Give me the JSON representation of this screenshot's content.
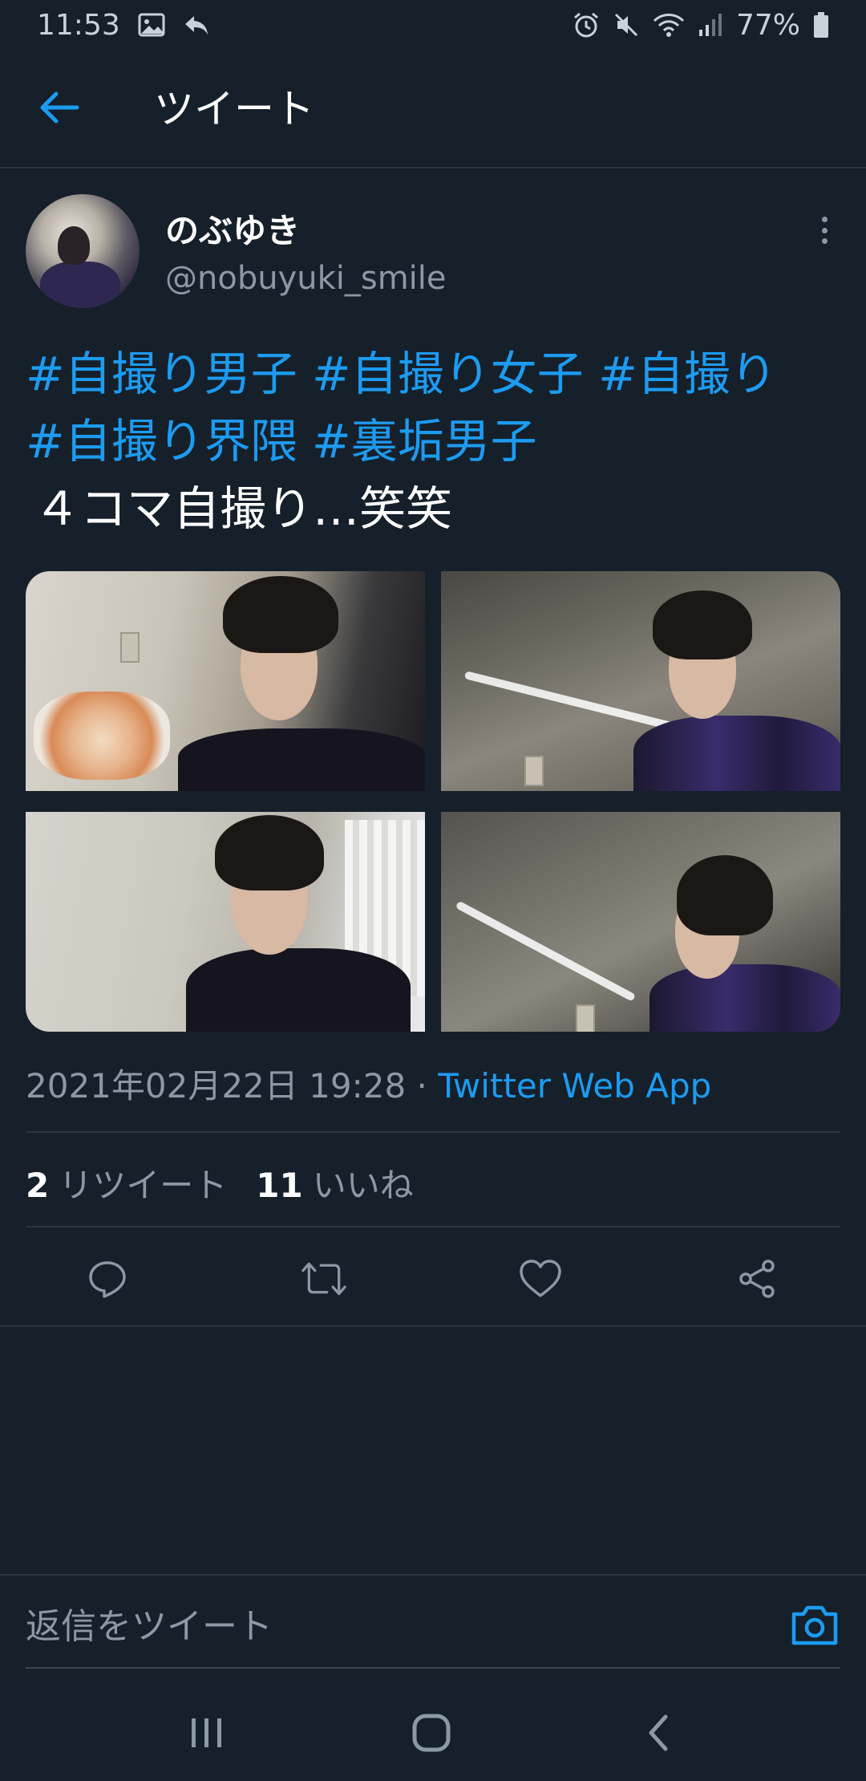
{
  "status_bar": {
    "time": "11:53",
    "battery": "77%",
    "icons": [
      "image-icon",
      "reply-arrow-icon",
      "alarm-icon",
      "mute-icon",
      "wifi-icon",
      "signal-icon",
      "battery-icon"
    ]
  },
  "header": {
    "title": "ツイート",
    "back_icon": "arrow-left-icon"
  },
  "tweet": {
    "author_name": "のぶゆき",
    "author_handle": "@nobuyuki_smile",
    "hashtags": [
      "#自撮り男子",
      "#自撮り女子",
      "#自撮り",
      "#自撮り界隈",
      "#裏垢男子"
    ],
    "body": "４コマ自撮り…笑笑",
    "timestamp": "2021年02月22日 19:28 · ",
    "source": "Twitter Web App",
    "retweets_count": "2",
    "retweets_label": "リツイート",
    "likes_count": "11",
    "likes_label": "いいね",
    "photo_count": 4
  },
  "actions": [
    "reply-icon",
    "retweet-icon",
    "like-icon",
    "share-icon"
  ],
  "reply_bar": {
    "placeholder": "返信をツイート",
    "camera_icon": "camera-icon"
  },
  "nav_bar": [
    "recents-icon",
    "home-icon",
    "back-icon"
  ],
  "colors": {
    "background": "#15202b",
    "accent": "#1d9bf0",
    "secondary_text": "#8b98a5",
    "divider": "#2b3640"
  }
}
